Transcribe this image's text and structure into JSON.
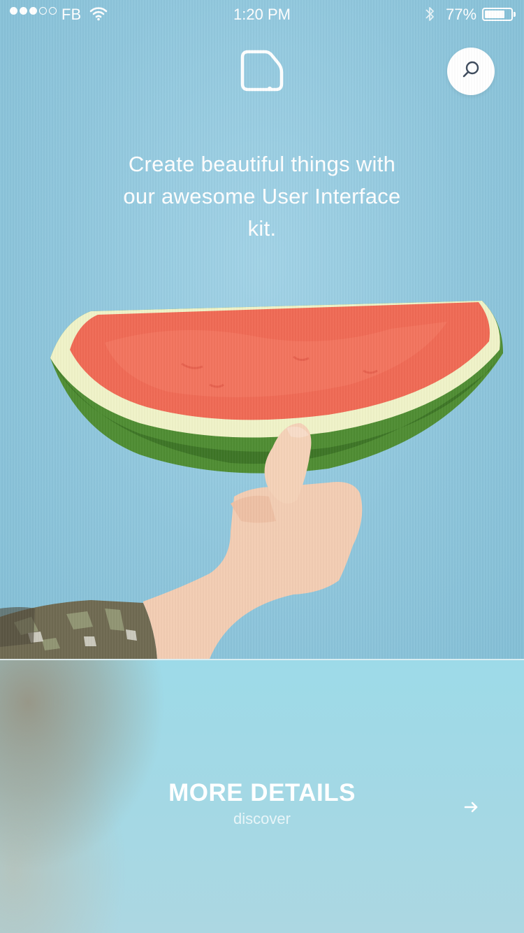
{
  "status_bar": {
    "carrier": "FB",
    "time": "1:20 PM",
    "battery_percent": "77%",
    "signal_strength": 3,
    "signal_max": 5,
    "battery_level": 0.77
  },
  "header": {
    "logo_icon": "document-logo-icon",
    "search_icon": "search-icon"
  },
  "hero": {
    "headline": "Create beautiful things with our awesome User Interface kit."
  },
  "cta": {
    "title": "MORE DETAILS",
    "subtitle": "discover",
    "arrow_icon": "arrow-right-icon"
  },
  "colors": {
    "background": "#8ec3d8",
    "panel": "#a0d8e6",
    "text": "#ffffff"
  }
}
